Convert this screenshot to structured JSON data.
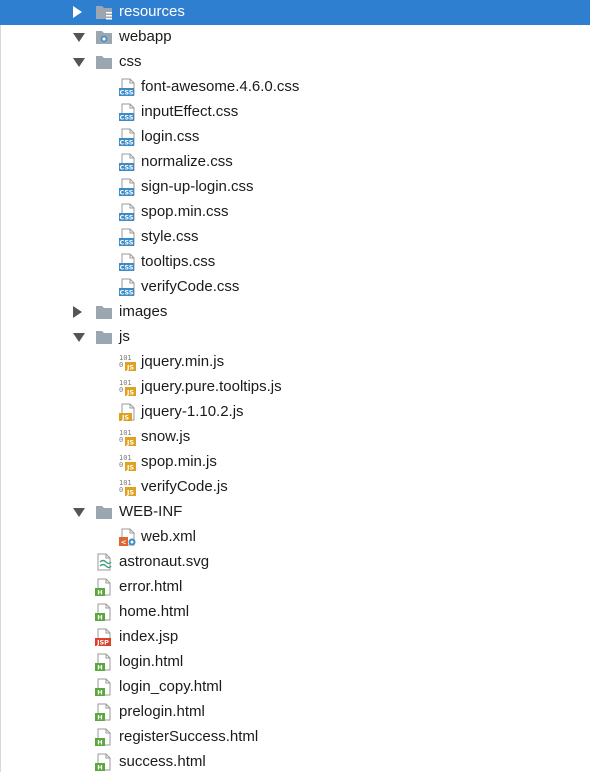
{
  "tree": {
    "rows": [
      {
        "label": "resources",
        "icon": "resources-folder-icon",
        "expander": "collapsed",
        "selected": true
      },
      {
        "label": "webapp",
        "icon": "web-folder-icon",
        "expander": "expanded"
      },
      {
        "label": "css",
        "icon": "folder-icon",
        "expander": "expanded"
      },
      {
        "label": "font-awesome.4.6.0.css",
        "icon": "css-file-icon"
      },
      {
        "label": "inputEffect.css",
        "icon": "css-file-icon"
      },
      {
        "label": "login.css",
        "icon": "css-file-icon"
      },
      {
        "label": "normalize.css",
        "icon": "css-file-icon"
      },
      {
        "label": "sign-up-login.css",
        "icon": "css-file-icon"
      },
      {
        "label": "spop.min.css",
        "icon": "css-file-icon"
      },
      {
        "label": "style.css",
        "icon": "css-file-icon"
      },
      {
        "label": "tooltips.css",
        "icon": "css-file-icon"
      },
      {
        "label": "verifyCode.css",
        "icon": "css-file-icon"
      },
      {
        "label": "images",
        "icon": "folder-icon",
        "expander": "collapsed"
      },
      {
        "label": "js",
        "icon": "folder-icon",
        "expander": "expanded"
      },
      {
        "label": "jquery.min.js",
        "icon": "minified-js-file-icon"
      },
      {
        "label": "jquery.pure.tooltips.js",
        "icon": "minified-js-file-icon"
      },
      {
        "label": "jquery-1.10.2.js",
        "icon": "js-file-icon"
      },
      {
        "label": "snow.js",
        "icon": "minified-js-file-icon"
      },
      {
        "label": "spop.min.js",
        "icon": "minified-js-file-icon"
      },
      {
        "label": "verifyCode.js",
        "icon": "minified-js-file-icon"
      },
      {
        "label": "WEB-INF",
        "icon": "folder-icon",
        "expander": "expanded"
      },
      {
        "label": "web.xml",
        "icon": "xml-file-icon"
      },
      {
        "label": "astronaut.svg",
        "icon": "svg-file-icon"
      },
      {
        "label": "error.html",
        "icon": "html-file-icon"
      },
      {
        "label": "home.html",
        "icon": "html-file-icon"
      },
      {
        "label": "index.jsp",
        "icon": "jsp-file-icon"
      },
      {
        "label": "login.html",
        "icon": "html-file-icon"
      },
      {
        "label": "login_copy.html",
        "icon": "html-file-icon"
      },
      {
        "label": "prelogin.html",
        "icon": "html-file-icon"
      },
      {
        "label": "registerSuccess.html",
        "icon": "html-file-icon"
      },
      {
        "label": "success.html",
        "icon": "html-file-icon"
      }
    ]
  },
  "colors": {
    "selection": "#2f7fd0",
    "folder": "#9aa7b0",
    "css_badge": "#3b8bc7",
    "js_badge": "#e0a020",
    "html_badge": "#5aa83c",
    "jsp_badge": "#d9412b",
    "xml_badge": "#e0662c"
  }
}
